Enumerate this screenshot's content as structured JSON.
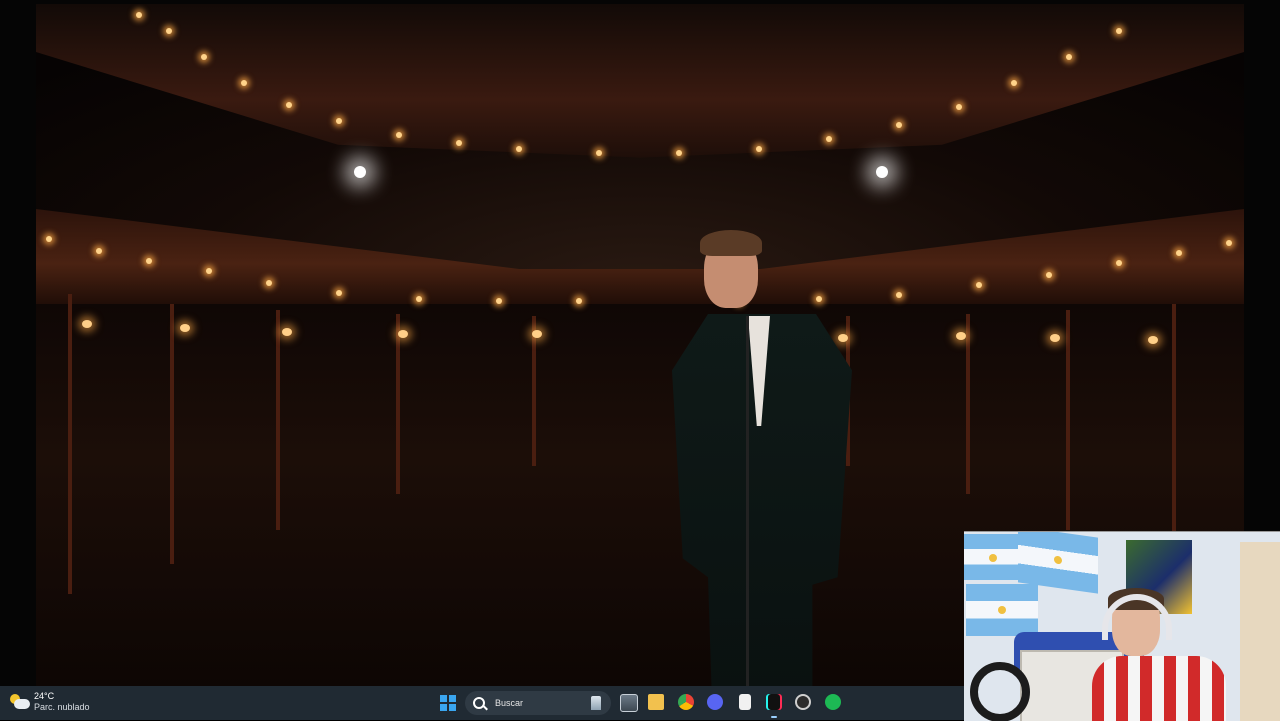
{
  "taskbar": {
    "weather": {
      "temperature": "24°C",
      "condition": "Parc. nublado",
      "icon": "partly-cloudy-icon"
    },
    "search": {
      "placeholder": "Buscar",
      "icon": "search-icon"
    },
    "apps": [
      {
        "name": "start-icon"
      },
      {
        "name": "search-icon"
      },
      {
        "name": "task-view-icon"
      },
      {
        "name": "file-explorer-icon"
      },
      {
        "name": "chrome-icon"
      },
      {
        "name": "discord-icon"
      },
      {
        "name": "document-icon"
      },
      {
        "name": "tiktok-icon"
      },
      {
        "name": "obs-icon"
      },
      {
        "name": "spotify-icon"
      }
    ],
    "colors": {
      "background": "#202a33",
      "start": "#3aa6f0",
      "spotify": "#1db954"
    }
  }
}
